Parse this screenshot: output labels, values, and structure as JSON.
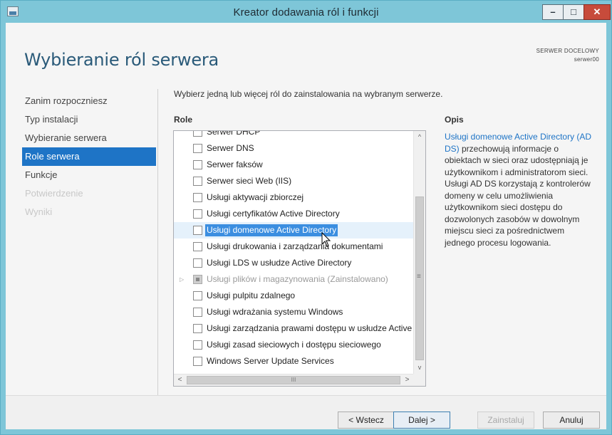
{
  "window": {
    "title": "Kreator dodawania ról i funkcji",
    "minimize": "–",
    "maximize": "□",
    "close": "✕"
  },
  "header": {
    "title": "Wybieranie ról serwera",
    "server_label": "SERWER DOCELOWY",
    "server_name": "serwer00"
  },
  "nav": {
    "items": [
      {
        "label": "Zanim rozpoczniesz",
        "state": "normal"
      },
      {
        "label": "Typ instalacji",
        "state": "normal"
      },
      {
        "label": "Wybieranie serwera",
        "state": "normal"
      },
      {
        "label": "Role serwera",
        "state": "active"
      },
      {
        "label": "Funkcje",
        "state": "normal"
      },
      {
        "label": "Potwierdzenie",
        "state": "disabled"
      },
      {
        "label": "Wyniki",
        "state": "disabled"
      }
    ]
  },
  "main": {
    "instruction": "Wybierz jedną lub więcej ról do zainstalowania na wybranym serwerze.",
    "roles_header": "Role",
    "roles": [
      {
        "label": "Serwer DHCP",
        "checked": false
      },
      {
        "label": "Serwer DNS",
        "checked": false
      },
      {
        "label": "Serwer faksów",
        "checked": false
      },
      {
        "label": "Serwer sieci Web (IIS)",
        "checked": false
      },
      {
        "label": "Usługi aktywacji zbiorczej",
        "checked": false
      },
      {
        "label": "Usługi certyfikatów Active Directory",
        "checked": false
      },
      {
        "label": "Usługi domenowe Active Directory",
        "checked": false
      },
      {
        "label": "Usługi drukowania i zarządzania dokumentami",
        "checked": false
      },
      {
        "label": "Usługi LDS w usłudze Active Directory",
        "checked": false
      },
      {
        "label": "Usługi plików i magazynowania (Zainstalowano)",
        "checked": true
      },
      {
        "label": "Usługi pulpitu zdalnego",
        "checked": false
      },
      {
        "label": "Usługi wdrażania systemu Windows",
        "checked": false
      },
      {
        "label": "Usługi zarządzania prawami dostępu w usłudze Active Directory",
        "checked": false
      },
      {
        "label": "Usługi zasad sieciowych i dostępu sieciowego",
        "checked": false
      },
      {
        "label": "Windows Server Update Services",
        "checked": false
      }
    ],
    "expander_glyph": "▷",
    "scroll": {
      "up": "^",
      "down": "v",
      "left": "<",
      "right": ">",
      "grip": "≡",
      "hgrip": "III"
    }
  },
  "description": {
    "header": "Opis",
    "highlight": "Usługi domenowe Active Directory (AD DS)",
    "body": " przechowują informacje o obiektach w sieci oraz udostępniają je użytkownikom i administratorom sieci. Usługi AD DS korzystają z kontrolerów domeny w celu umożliwienia użytkownikom sieci dostępu do dozwolonych zasobów w dowolnym miejscu sieci za pośrednictwem jednego procesu logowania."
  },
  "buttons": {
    "back": "< Wstecz",
    "next": "Dalej >",
    "install": "Zainstaluj",
    "cancel": "Anuluj"
  },
  "colors": {
    "accent": "#1e74c6",
    "title_bar": "#7ec6d8",
    "page_title": "#2a5a79",
    "close_button": "#c74b3b"
  }
}
